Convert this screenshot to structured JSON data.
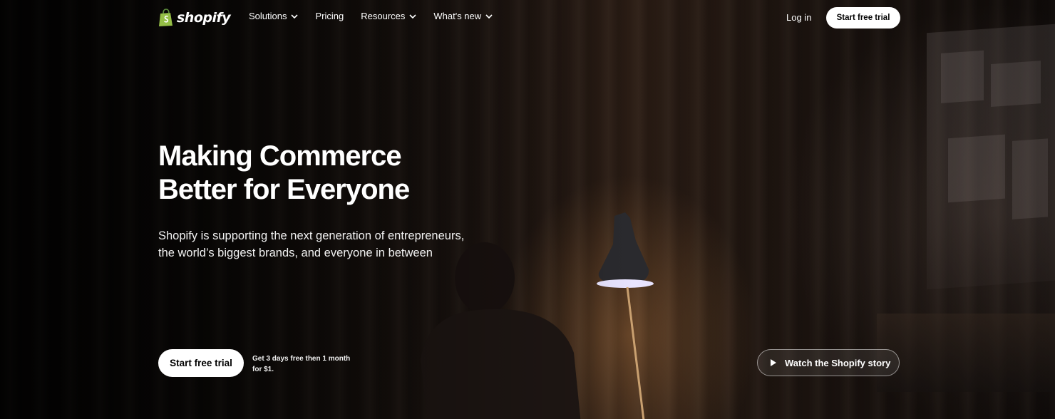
{
  "nav": {
    "logo_text": "shopify",
    "menu": [
      {
        "label": "Solutions",
        "has_dropdown": true
      },
      {
        "label": "Pricing",
        "has_dropdown": false
      },
      {
        "label": "Resources",
        "has_dropdown": true
      },
      {
        "label": "What's new",
        "has_dropdown": true
      }
    ],
    "login_label": "Log in",
    "cta_label": "Start free trial"
  },
  "hero": {
    "headline_line1": "Making Commerce",
    "headline_line2": "Better for Everyone",
    "sub_line1": "Shopify is supporting the next generation of entrepreneurs,",
    "sub_line2": "the world’s biggest brands, and everyone in between",
    "cta_label": "Start free trial",
    "offer_text": "Get 3 days free then 1 month for $1.",
    "watch_label": "Watch the Shopify story"
  },
  "icons": {
    "logo": "shopify-bag-icon",
    "dropdown": "chevron-down-icon",
    "play": "play-icon"
  },
  "colors": {
    "brand_green": "#95bf47",
    "button_bg": "#ffffff",
    "button_text": "#000000"
  }
}
